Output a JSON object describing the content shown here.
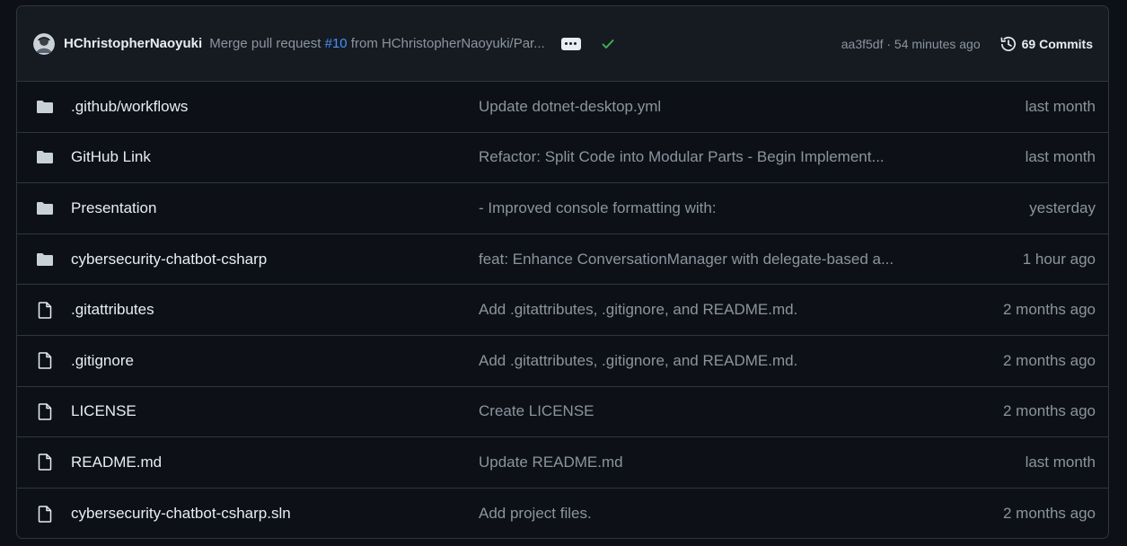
{
  "header": {
    "author": "HChristopherNaoyuki",
    "message_prefix": "Merge pull request ",
    "pr_number": "#10",
    "message_suffix": " from HChristopherNaoyuki/Par...",
    "sha_time": "aa3f5df · 54 minutes ago",
    "commits_label": "69 Commits",
    "status": "success"
  },
  "colors": {
    "background": "#0d1117",
    "header_bg": "#161b22",
    "border": "#30363d",
    "link": "#4493f8",
    "success": "#3fb950",
    "text": "#e6edf3",
    "muted": "#8b949e"
  },
  "files": [
    {
      "type": "folder",
      "icon": "folder-icon",
      "name": ".github/workflows",
      "message": "Update dotnet-desktop.yml",
      "date": "last month"
    },
    {
      "type": "folder",
      "icon": "folder-icon",
      "name": "GitHub Link",
      "message": "Refactor: Split Code into Modular Parts - Begin Implement...",
      "date": "last month"
    },
    {
      "type": "folder",
      "icon": "folder-icon",
      "name": "Presentation",
      "message": "- Improved console formatting with:",
      "date": "yesterday"
    },
    {
      "type": "folder",
      "icon": "folder-icon",
      "name": "cybersecurity-chatbot-csharp",
      "message": "feat: Enhance ConversationManager with delegate-based a...",
      "date": "1 hour ago"
    },
    {
      "type": "file",
      "icon": "file-icon",
      "name": ".gitattributes",
      "message": "Add .gitattributes, .gitignore, and README.md.",
      "date": "2 months ago"
    },
    {
      "type": "file",
      "icon": "file-icon",
      "name": ".gitignore",
      "message": "Add .gitattributes, .gitignore, and README.md.",
      "date": "2 months ago"
    },
    {
      "type": "file",
      "icon": "file-icon",
      "name": "LICENSE",
      "message": "Create LICENSE",
      "date": "2 months ago"
    },
    {
      "type": "file",
      "icon": "file-icon",
      "name": "README.md",
      "message": "Update README.md",
      "date": "last month"
    },
    {
      "type": "file",
      "icon": "file-icon",
      "name": "cybersecurity-chatbot-csharp.sln",
      "message": "Add project files.",
      "date": "2 months ago"
    }
  ]
}
